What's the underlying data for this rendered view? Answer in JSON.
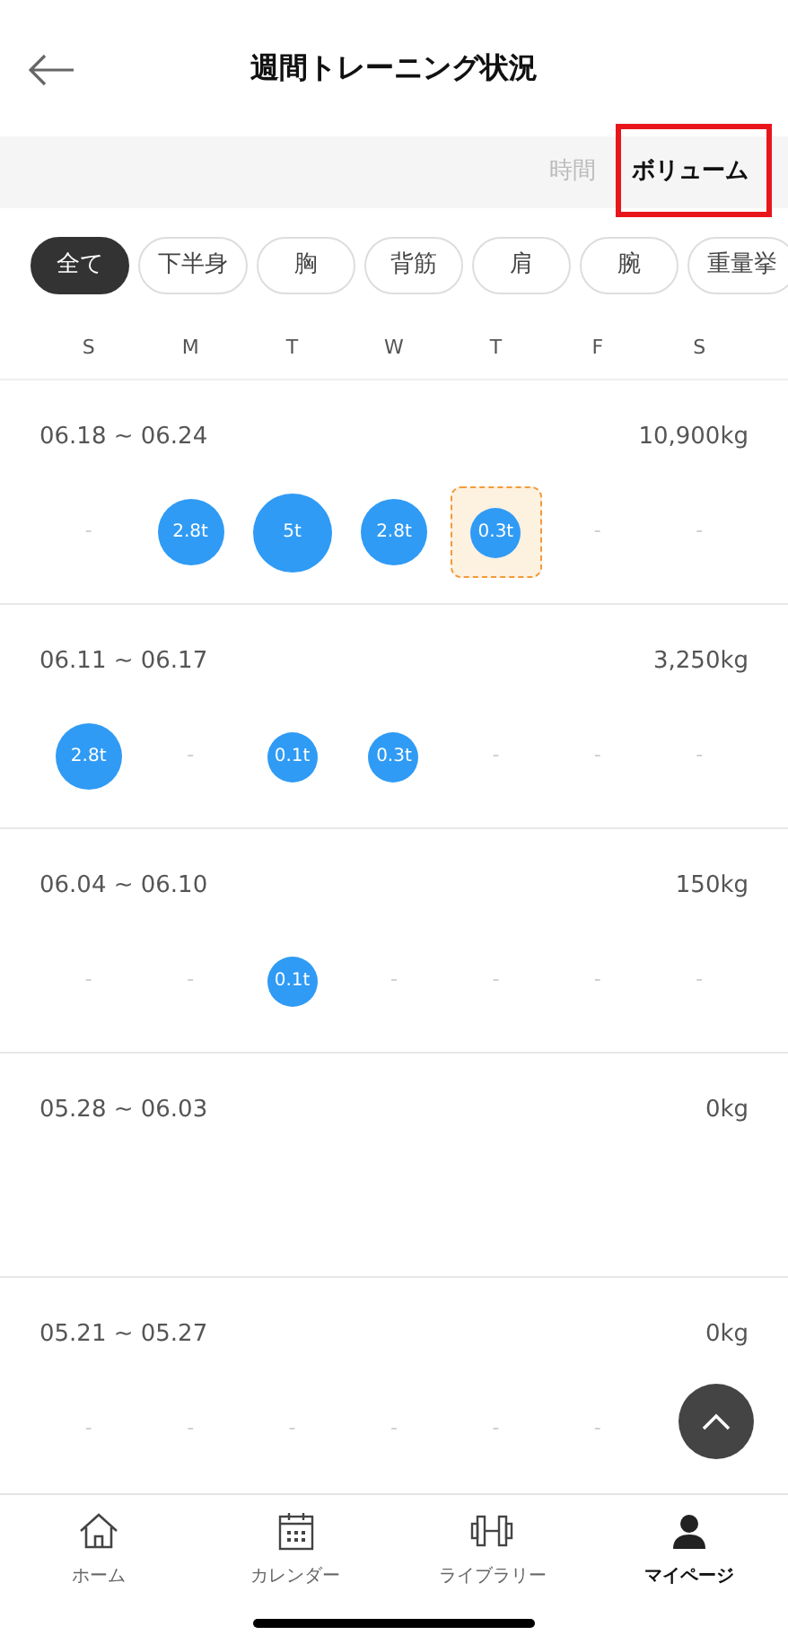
{
  "header": {
    "title": "週間トレーニング状況"
  },
  "mode_tabs": [
    {
      "label": "時間",
      "selected": false
    },
    {
      "label": "ボリューム",
      "selected": true
    }
  ],
  "filters": [
    {
      "label": "全て",
      "selected": true
    },
    {
      "label": "下半身",
      "selected": false
    },
    {
      "label": "胸",
      "selected": false
    },
    {
      "label": "背筋",
      "selected": false
    },
    {
      "label": "肩",
      "selected": false
    },
    {
      "label": "腕",
      "selected": false
    },
    {
      "label": "重量挙",
      "selected": false
    }
  ],
  "weekdays": [
    "S",
    "M",
    "T",
    "W",
    "T",
    "F",
    "S"
  ],
  "weeks": [
    {
      "range": "06.18 ~ 06.24",
      "total": "10,900kg",
      "days": [
        {
          "kind": "empty",
          "text": "-"
        },
        {
          "kind": "medium",
          "text": "2.8t"
        },
        {
          "kind": "large",
          "text": "5t"
        },
        {
          "kind": "medium",
          "text": "2.8t"
        },
        {
          "kind": "small",
          "text": "0.3t",
          "today": true
        },
        {
          "kind": "empty",
          "text": "-"
        },
        {
          "kind": "empty",
          "text": "-"
        }
      ]
    },
    {
      "range": "06.11 ~ 06.17",
      "total": "3,250kg",
      "days": [
        {
          "kind": "medium",
          "text": "2.8t"
        },
        {
          "kind": "empty",
          "text": "-"
        },
        {
          "kind": "small",
          "text": "0.1t"
        },
        {
          "kind": "small",
          "text": "0.3t"
        },
        {
          "kind": "empty",
          "text": "-"
        },
        {
          "kind": "empty",
          "text": "-"
        },
        {
          "kind": "empty",
          "text": "-"
        }
      ]
    },
    {
      "range": "06.04 ~ 06.10",
      "total": "150kg",
      "days": [
        {
          "kind": "empty",
          "text": "-"
        },
        {
          "kind": "empty",
          "text": "-"
        },
        {
          "kind": "small",
          "text": "0.1t"
        },
        {
          "kind": "empty",
          "text": "-"
        },
        {
          "kind": "empty",
          "text": "-"
        },
        {
          "kind": "empty",
          "text": "-"
        },
        {
          "kind": "empty",
          "text": "-"
        }
      ]
    },
    {
      "range": "05.28 ~ 06.03",
      "total": "0kg"
    },
    {
      "range": "05.21 ~ 05.27",
      "total": "0kg",
      "days": [
        {
          "kind": "empty",
          "text": "-"
        },
        {
          "kind": "empty",
          "text": "-"
        },
        {
          "kind": "empty",
          "text": "-"
        },
        {
          "kind": "empty",
          "text": "-"
        },
        {
          "kind": "empty",
          "text": "-"
        },
        {
          "kind": "empty",
          "text": "-"
        }
      ]
    }
  ],
  "nav": [
    {
      "label": "ホーム",
      "selected": false
    },
    {
      "label": "カレンダー",
      "selected": false
    },
    {
      "label": "ライブラリー",
      "selected": false
    },
    {
      "label": "マイページ",
      "selected": true
    }
  ]
}
